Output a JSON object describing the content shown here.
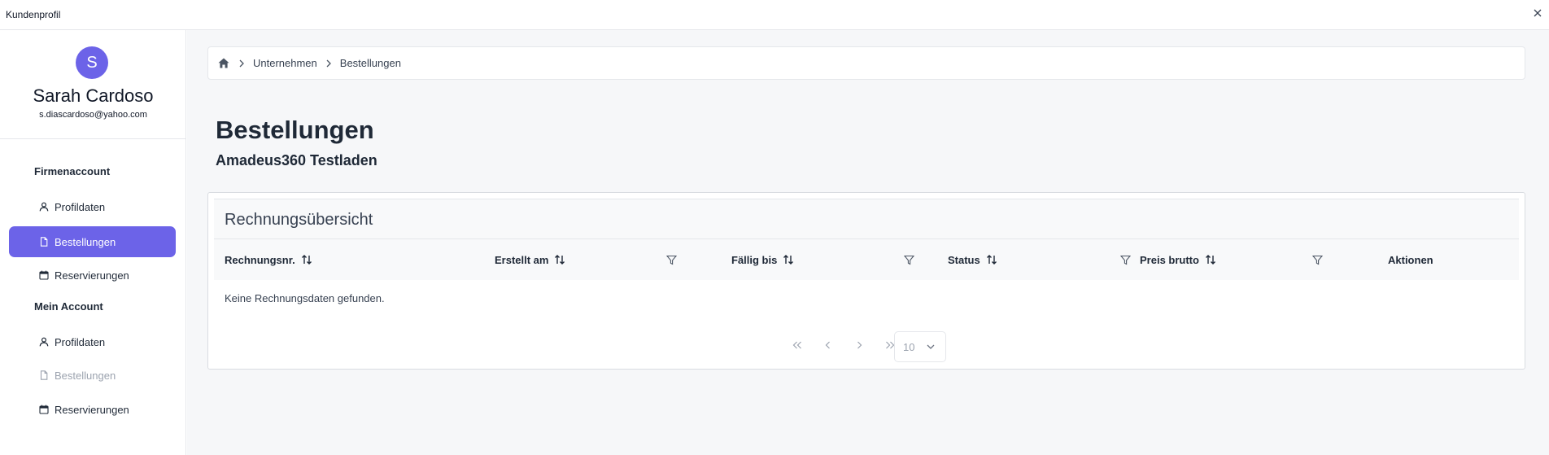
{
  "window": {
    "title": "Kundenprofil"
  },
  "profile": {
    "initial": "S",
    "name": "Sarah Cardoso",
    "email": "s.diascardoso@yahoo.com"
  },
  "sidebar": {
    "sections": [
      {
        "label": "Firmenaccount",
        "items": [
          {
            "label": "Profildaten",
            "icon": "user-icon",
            "state": "normal"
          },
          {
            "label": "Bestellungen",
            "icon": "document-icon",
            "state": "active"
          },
          {
            "label": "Reservierungen",
            "icon": "calendar-icon",
            "state": "normal"
          }
        ]
      },
      {
        "label": "Mein Account",
        "items": [
          {
            "label": "Profildaten",
            "icon": "user-icon",
            "state": "normal"
          },
          {
            "label": "Bestellungen",
            "icon": "document-icon",
            "state": "disabled"
          },
          {
            "label": "Reservierungen",
            "icon": "calendar-icon",
            "state": "normal"
          }
        ]
      }
    ]
  },
  "breadcrumb": {
    "items": [
      "Unternehmen",
      "Bestellungen"
    ]
  },
  "page": {
    "title": "Bestellungen",
    "subtitle": "Amadeus360 Testladen"
  },
  "table": {
    "title": "Rechnungsübersicht",
    "columns": [
      "Rechnungsnr.",
      "Erstellt am",
      "Fällig bis",
      "Status",
      "Preis brutto",
      "Aktionen"
    ],
    "empty_message": "Keine Rechnungsdaten gefunden.",
    "rows_per_page": "10"
  },
  "colors": {
    "accent": "#6c63e8",
    "background": "#f6f7f9",
    "text": "#1f2937"
  }
}
